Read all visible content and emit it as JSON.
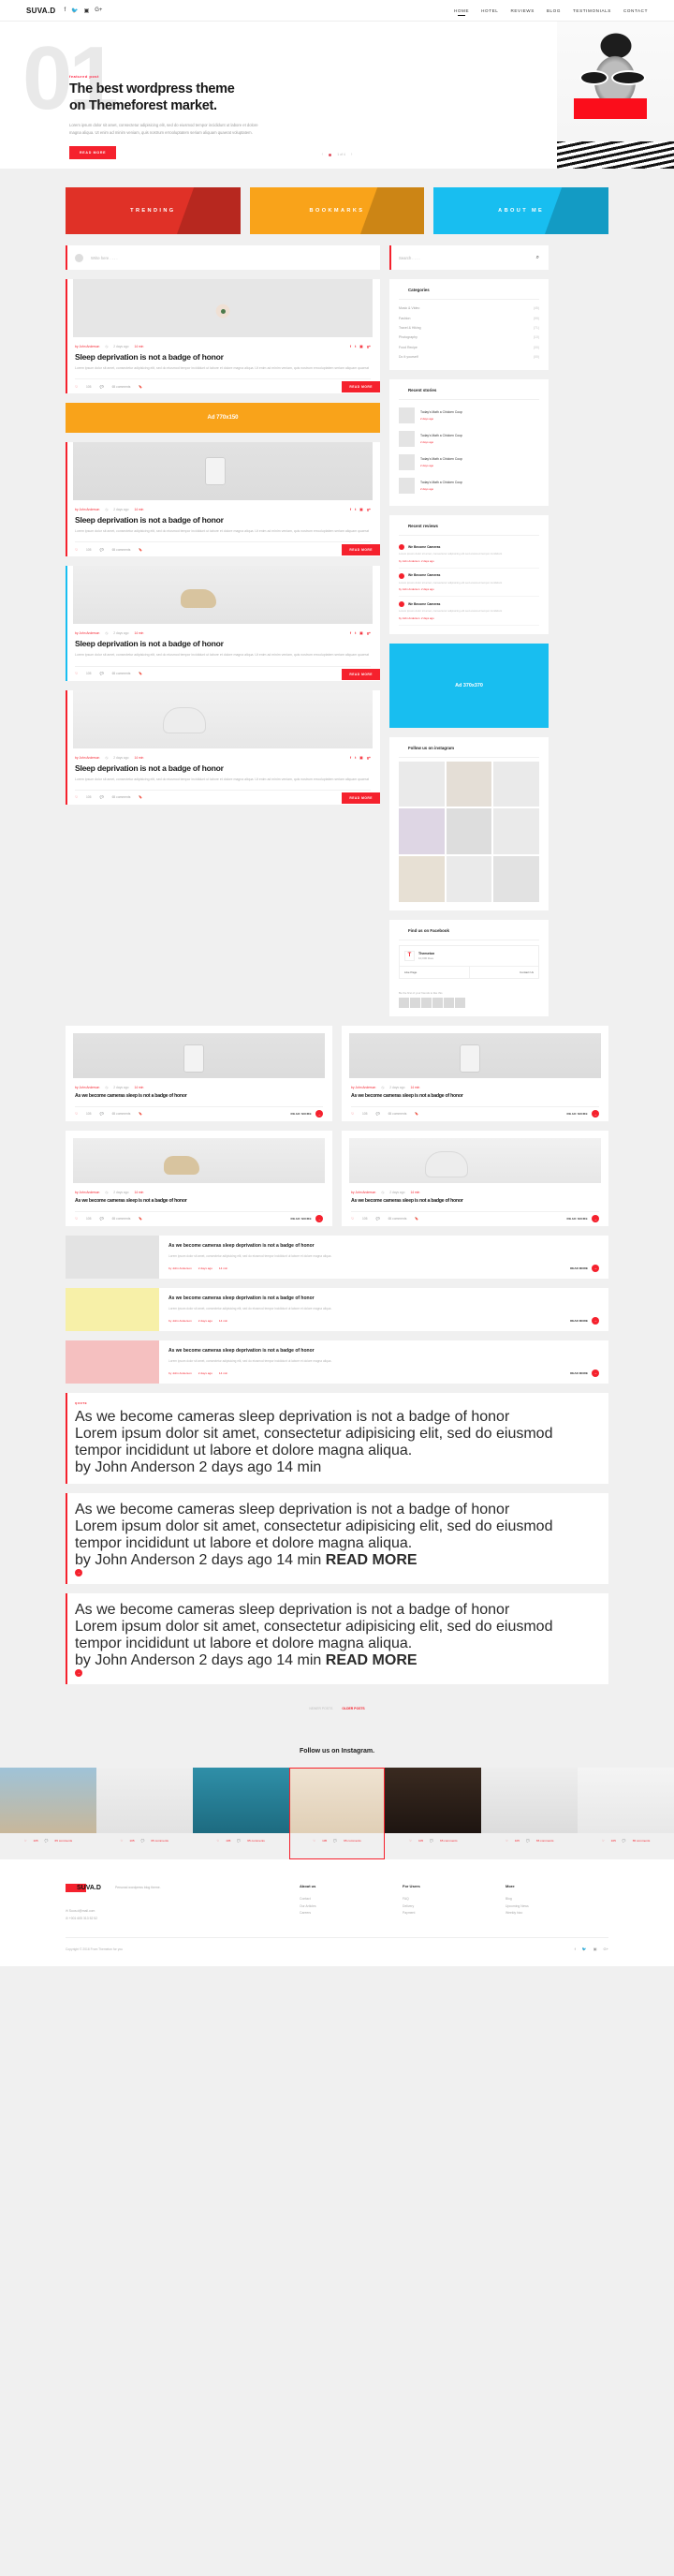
{
  "header": {
    "brand": "SUVA.D",
    "social": [
      "facebook-icon",
      "twitter-icon",
      "instagram-icon",
      "google-plus-icon"
    ],
    "nav": [
      {
        "label": "HOME",
        "active": true
      },
      {
        "label": "HOTEL",
        "active": false
      },
      {
        "label": "REVIEWS",
        "active": false
      },
      {
        "label": "BLOG",
        "active": false
      },
      {
        "label": "TESTIMONIALS",
        "active": false
      },
      {
        "label": "CONTACT",
        "active": false
      }
    ]
  },
  "hero": {
    "number": "01",
    "kicker": "featured post",
    "title_line1": "The best wordpress theme",
    "title_line2": "on Themeforest market.",
    "text": "Lorem ipsum dolor sit amet, consectetur adipisicing elit, sed do eiusmod tempor incididunt ut labore et dolore magna aliqua. Ut enim ad minim veniam, quis nostrum errooluptatem seriam aliquam quaerat voluptatem.",
    "button": "READ MORE",
    "pagination": "1 of 4"
  },
  "tiles": [
    {
      "label": "TRENDING",
      "color": "#e03127"
    },
    {
      "label": "BOOKMARKS",
      "color": "#f9a31a"
    },
    {
      "label": "ABOUT ME",
      "color": "#18bef0"
    }
  ],
  "write_bar": {
    "placeholder": "Write here . . . ."
  },
  "search_bar": {
    "placeholder": "Search . . . .",
    "icon": "search-icon"
  },
  "posts": [
    {
      "author": "by John Anderson",
      "date": "2 days ago",
      "read_time": "14 min",
      "title": "Sleep deprivation is not a badge of honor",
      "excerpt": "Lorem ipsum dolor sit amet, consectetur adipisicing elit, sed do eiusmod tempor incididunt ut labore et dolore magna aliqua. Ut enim ad minim veniam, quis nostrum errooluptatem  seriam aliquam quaerat",
      "likes": "105",
      "comments": "65 comments",
      "read_more": "READ MORE"
    },
    {
      "author": "by John Anderson",
      "date": "2 days ago",
      "read_time": "14 min",
      "title": "Sleep deprivation is not a badge of honor",
      "excerpt": "Lorem ipsum dolor sit amet, consectetur adipisicing elit, sed do eiusmod tempor incididunt ut labore et dolore magna aliqua. Ut enim ad minim veniam, quis nostrum errooluptatem  seriam aliquam quaerat",
      "likes": "105",
      "comments": "65 comments",
      "read_more": "READ MORE"
    },
    {
      "author": "by John Anderson",
      "date": "2 days ago",
      "read_time": "14 min",
      "title": "Sleep deprivation is not a badge of honor",
      "excerpt": "Lorem ipsum dolor sit amet, consectetur adipisicing elit, sed do eiusmod tempor incididunt ut labore et dolore magna aliqua. Ut enim ad minim veniam, quis nostrum errooluptatem  seriam aliquam quaerat",
      "likes": "105",
      "comments": "65 comments",
      "read_more": "READ MORE"
    },
    {
      "author": "by John Anderson",
      "date": "2 days ago",
      "read_time": "14 min",
      "title": "Sleep deprivation is not a badge of honor",
      "excerpt": "Lorem ipsum dolor sit amet, consectetur adipisicing elit, sed do eiusmod tempor incididunt ut labore et dolore magna aliqua. Ut enim ad minim veniam, quis nostrum errooluptatem  seriam aliquam quaerat",
      "likes": "105",
      "comments": "65 comments",
      "read_more": "READ MORE"
    }
  ],
  "ads": [
    {
      "label": "Ad 770x150",
      "color": "#f9a31a"
    },
    {
      "label": "Ad 370x370",
      "color": "#18bef0"
    }
  ],
  "grid_posts": [
    {
      "author": "by John Anderson",
      "date": "2 days ago",
      "read_time": "14 min",
      "title": "As we become cameras sleep is not a badge of honor",
      "likes": "105",
      "comments": "65 comments",
      "read_more": "READ MORE"
    },
    {
      "author": "by John Anderson",
      "date": "2 days ago",
      "read_time": "14 min",
      "title": "As we become cameras sleep is not a badge of honor",
      "likes": "105",
      "comments": "65 comments",
      "read_more": "READ MORE"
    },
    {
      "author": "by John Anderson",
      "date": "2 days ago",
      "read_time": "14 min",
      "title": "As we become cameras sleep is not a badge of honor",
      "likes": "105",
      "comments": "65 comments",
      "read_more": "READ MORE"
    },
    {
      "author": "by John Anderson",
      "date": "2 days ago",
      "read_time": "14 min",
      "title": "As we become cameras sleep is not a badge of honor",
      "likes": "105",
      "comments": "65 comments",
      "read_more": "READ MORE"
    }
  ],
  "list_posts": [
    {
      "title": "As we become cameras sleep deprivation is not a badge of honor",
      "excerpt": "Lorem ipsum dolor sit amet, consectetur adipisicing elit, sed do eiusmod tempor incididunt ut labore et dolore magna aliqua.",
      "author": "by John Anderson",
      "date": "2 days ago",
      "read_time": "14 min",
      "read_more": "READ MORE",
      "thumb": "gray"
    },
    {
      "title": "As we become cameras sleep deprivation is not a badge of honor",
      "excerpt": "Lorem ipsum dolor sit amet, consectetur adipisicing elit, sed do eiusmod tempor incididunt ut labore et dolore magna aliqua.",
      "author": "by John Anderson",
      "date": "2 days ago",
      "read_time": "14 min",
      "read_more": "READ MORE",
      "thumb": "yellow"
    },
    {
      "title": "As we become cameras sleep deprivation is not a badge of honor",
      "excerpt": "Lorem ipsum dolor sit amet, consectetur adipisicing elit, sed do eiusmod tempor incididunt ut labore et dolore magna aliqua.",
      "author": "by John Anderson",
      "date": "2 days ago",
      "read_time": "14 min",
      "read_more": "READ MORE",
      "thumb": "red"
    }
  ],
  "text_posts": [
    {
      "tag": "QUOTE",
      "title": "As we become cameras sleep deprivation is not a badge of honor",
      "excerpt": "Lorem ipsum dolor sit amet, consectetur adipisicing elit, sed do eiusmod tempor incididunt ut labore et dolore magna aliqua.",
      "author": "by John Anderson",
      "date": "2 days ago",
      "read_time": "14 min"
    },
    {
      "tag": "",
      "title": "As we become cameras sleep deprivation is not a badge of honor",
      "excerpt": "Lorem ipsum dolor sit amet, consectetur adipisicing elit, sed do eiusmod tempor incididunt ut labore et dolore magna aliqua.",
      "author": "by John Anderson",
      "date": "2 days ago",
      "read_time": "14 min",
      "read_more": "READ MORE"
    },
    {
      "tag": "",
      "title": "As we become cameras sleep deprivation is not a badge of honor",
      "excerpt": "Lorem ipsum dolor sit amet, consectetur adipisicing elit, sed do eiusmod tempor incididunt ut labore et dolore magna aliqua.",
      "author": "by John Anderson",
      "date": "2 days ago",
      "read_time": "14 min",
      "read_more": "READ MORE"
    }
  ],
  "pager": {
    "newer": "NEWER POSTS",
    "older": "OLDER POSTS"
  },
  "sidebar": {
    "categories": {
      "title": "Categories",
      "items": [
        {
          "label": "Music & Video",
          "count": "(45)"
        },
        {
          "label": "Fashion",
          "count": "(99)"
        },
        {
          "label": "Travel & Hiking",
          "count": "(71)"
        },
        {
          "label": "Photography",
          "count": "(10)"
        },
        {
          "label": "Food Recipe",
          "count": "(00)"
        },
        {
          "label": "Do It yourself",
          "count": "(00)"
        }
      ]
    },
    "recent_stories": {
      "title": "Recent stories",
      "items": [
        {
          "title": "Today's Math a Chicken Coop",
          "date": "2 days ago"
        },
        {
          "title": "Today's Math a Chicken Coop",
          "date": "2 days ago"
        },
        {
          "title": "Today's Math a Chicken Coop",
          "date": "2 days ago"
        },
        {
          "title": "Today's Math a Chicken Coop",
          "date": "2 days ago"
        }
      ]
    },
    "recent_reviews": {
      "title": "Recent reviews",
      "items": [
        {
          "title": "We Become Cameras",
          "text": "Lorem ipsum dolor sit amet, consectetur adipisicing elit sed eiusmod tempor incididunt",
          "meta": "by John Anderson",
          "date": "2 days ago"
        },
        {
          "title": "We Become Cameras",
          "text": "Lorem ipsum dolor sit amet, consectetur adipisicing elit sed eiusmod tempor incididunt",
          "meta": "by John Anderson",
          "date": "2 days ago"
        },
        {
          "title": "We Become Cameras",
          "text": "Lorem ipsum dolor sit amet, consectetur adipisicing elit sed eiusmod tempor incididunt",
          "meta": "by John Anderson",
          "date": "2 days ago"
        }
      ]
    },
    "instagram": {
      "title": "Follow us on instagram"
    },
    "facebook": {
      "title": "Find us on Facebook",
      "page_name": "Themeton",
      "likes": "10,000 likes",
      "like_button": "Like Page",
      "contact_button": "Contact Us",
      "note": "Be the first of your friends to like this"
    }
  },
  "instagram_section": {
    "title": "Follow us on Instagram.",
    "items": [
      {
        "likes": "105",
        "comments": "65 comments",
        "selected": false
      },
      {
        "likes": "105",
        "comments": "65 comments",
        "selected": false
      },
      {
        "likes": "105",
        "comments": "65 comments",
        "selected": false
      },
      {
        "likes": "105",
        "comments": "65 comments",
        "selected": true
      },
      {
        "likes": "105",
        "comments": "65 comments",
        "selected": false
      },
      {
        "likes": "105",
        "comments": "65 comments",
        "selected": false
      },
      {
        "likes": "105",
        "comments": "65 comments",
        "selected": false
      }
    ]
  },
  "footer": {
    "brand": "SUVA.D",
    "tagline": "Personal wordpress blog theme.",
    "email": "Suva.d@mail.com",
    "phone": "+001 605 313 52 52",
    "columns": [
      {
        "title": "About us",
        "links": [
          "Contact",
          "Our Articles",
          "Careers"
        ]
      },
      {
        "title": "For Users",
        "links": [
          "FAQ",
          "Delivery",
          "Payment"
        ]
      },
      {
        "title": "More",
        "links": [
          "Blog",
          "Upcoming News",
          "Weekly hizo"
        ]
      }
    ],
    "copyright": "Copyright © 2016 From Themeton for you",
    "social": [
      "facebook-icon",
      "twitter-icon",
      "instagram-icon",
      "google-plus-icon"
    ]
  },
  "colors": {
    "accent": "#f5212d",
    "orange": "#f9a31a",
    "cyan": "#18bef0"
  }
}
